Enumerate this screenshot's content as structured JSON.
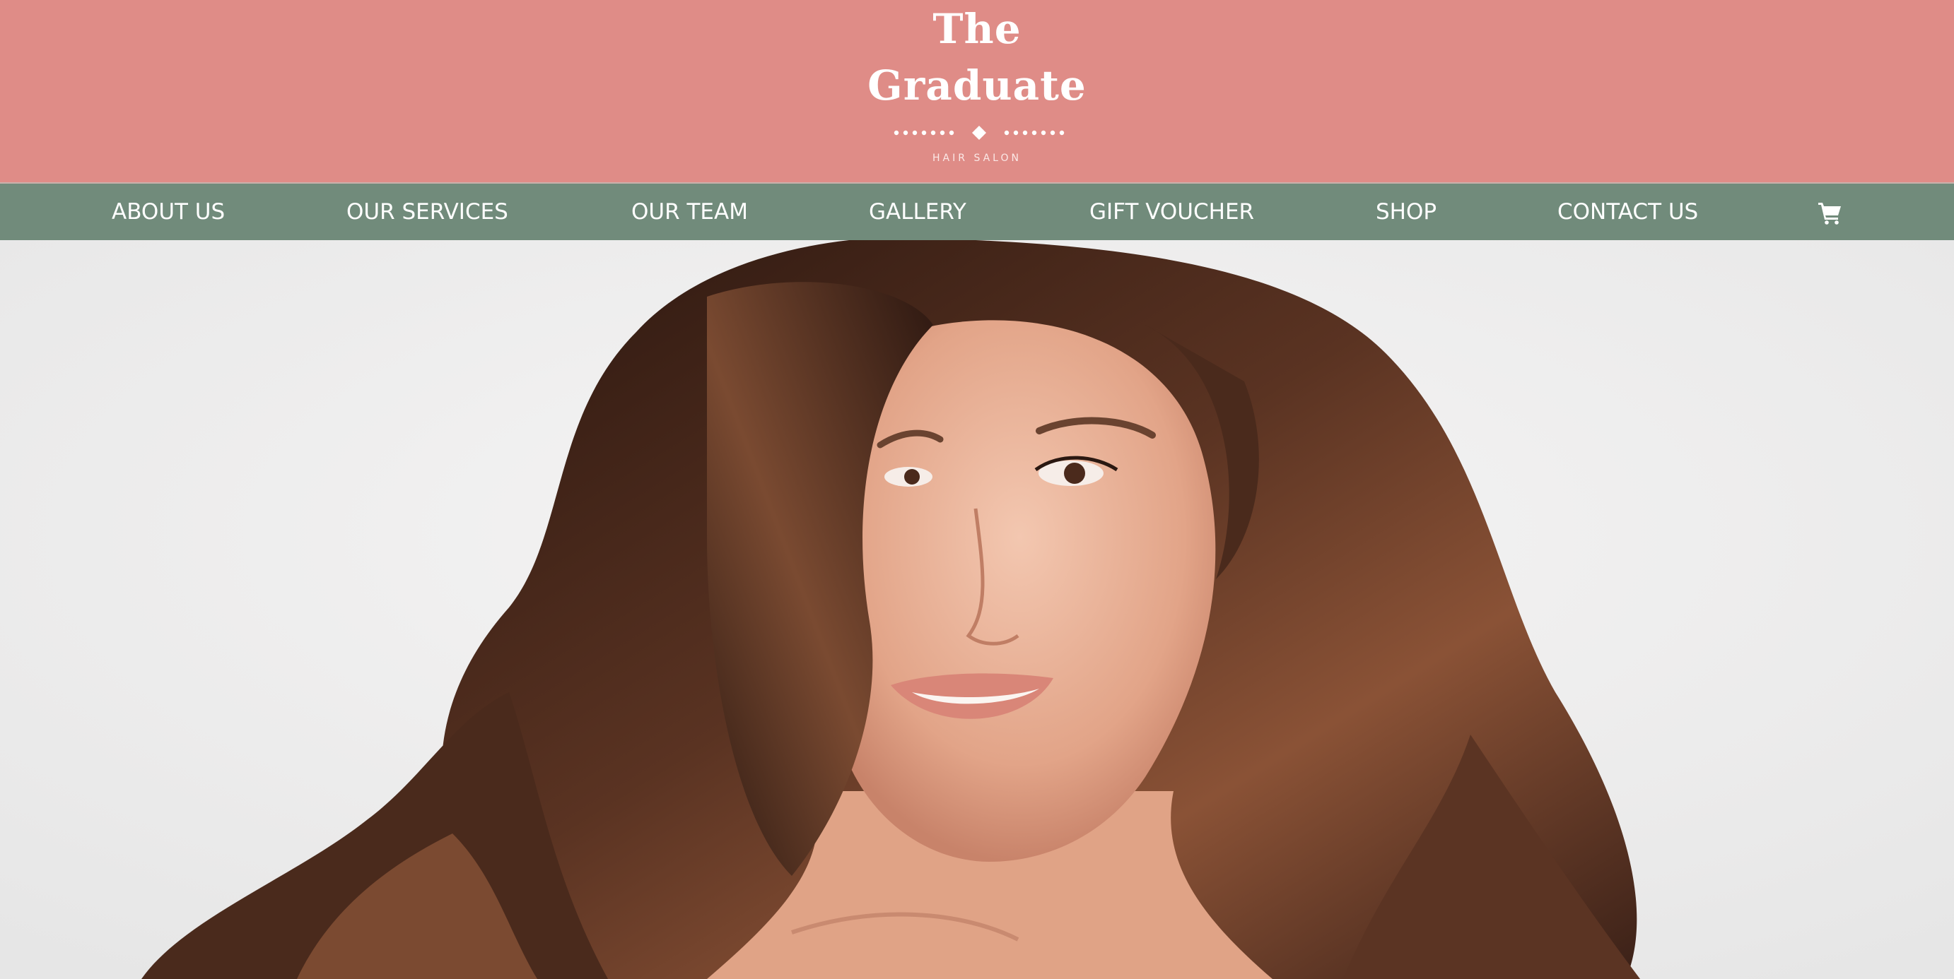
{
  "brand": {
    "title_line1": "The",
    "title_line2": "Graduate",
    "tagline": "HAIR SALON"
  },
  "nav": {
    "items": [
      {
        "label": "ABOUT US"
      },
      {
        "label": "OUR SERVICES"
      },
      {
        "label": "OUR TEAM"
      },
      {
        "label": "GALLERY"
      },
      {
        "label": "GIFT VOUCHER"
      },
      {
        "label": "SHOP"
      },
      {
        "label": "CONTACT US"
      }
    ],
    "cart_icon": "shopping-cart-icon"
  },
  "hero": {
    "image": "woman-long-brown-wavy-hair-portrait"
  },
  "colors": {
    "header_bg": "#df8c87",
    "nav_bg": "#718b7b",
    "text": "#ffffff",
    "hair": "#3d2418",
    "skin": "#e9b49c"
  }
}
